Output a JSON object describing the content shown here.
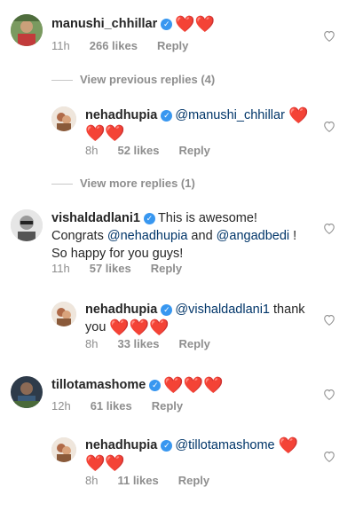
{
  "colors": {
    "accent": "#3897f0",
    "mention": "#003569",
    "heart": "#ed1c24",
    "meta": "#8e8e8e"
  },
  "icons": {
    "like": "heart-outline-icon",
    "verified": "verified-badge-icon"
  },
  "comments": [
    {
      "username": "manushi_chhillar",
      "verified": true,
      "hearts": "❤️❤️",
      "meta": {
        "time": "11h",
        "likes": "266 likes",
        "reply": "Reply"
      },
      "view_previous": "View previous replies (4)",
      "reply": {
        "username": "nehadhupia",
        "mention": "@manushi_chhillar",
        "hearts_line1": "❤️",
        "hearts_line2": "❤️❤️",
        "meta": {
          "time": "8h",
          "likes": "52 likes",
          "reply": "Reply"
        }
      },
      "view_more": "View more replies (1)"
    },
    {
      "username": "vishaldadlani1",
      "verified": true,
      "text_1": "This is awesome!",
      "text_2a": "Congrats ",
      "mention_1": "@nehadhupia",
      "text_2b": " and ",
      "mention_2": "@angadbedi",
      "text_2c": " !",
      "text_3": "So happy for you guys!",
      "meta": {
        "time": "11h",
        "likes": "57 likes",
        "reply": "Reply"
      },
      "reply": {
        "username": "nehadhupia",
        "mention": "@vishaldadlani1",
        "text": "thank",
        "text_line2": "you",
        "hearts": "❤️❤️❤️",
        "meta": {
          "time": "8h",
          "likes": "33 likes",
          "reply": "Reply"
        }
      }
    },
    {
      "username": "tillotamashome",
      "verified": true,
      "hearts": "❤️❤️❤️",
      "meta": {
        "time": "12h",
        "likes": "61 likes",
        "reply": "Reply"
      },
      "reply": {
        "username": "nehadhupia",
        "mention": "@tillotamashome",
        "hearts_line1": "❤️",
        "hearts_line2": "❤️❤️",
        "meta": {
          "time": "8h",
          "likes": "11 likes",
          "reply": "Reply"
        }
      }
    }
  ]
}
